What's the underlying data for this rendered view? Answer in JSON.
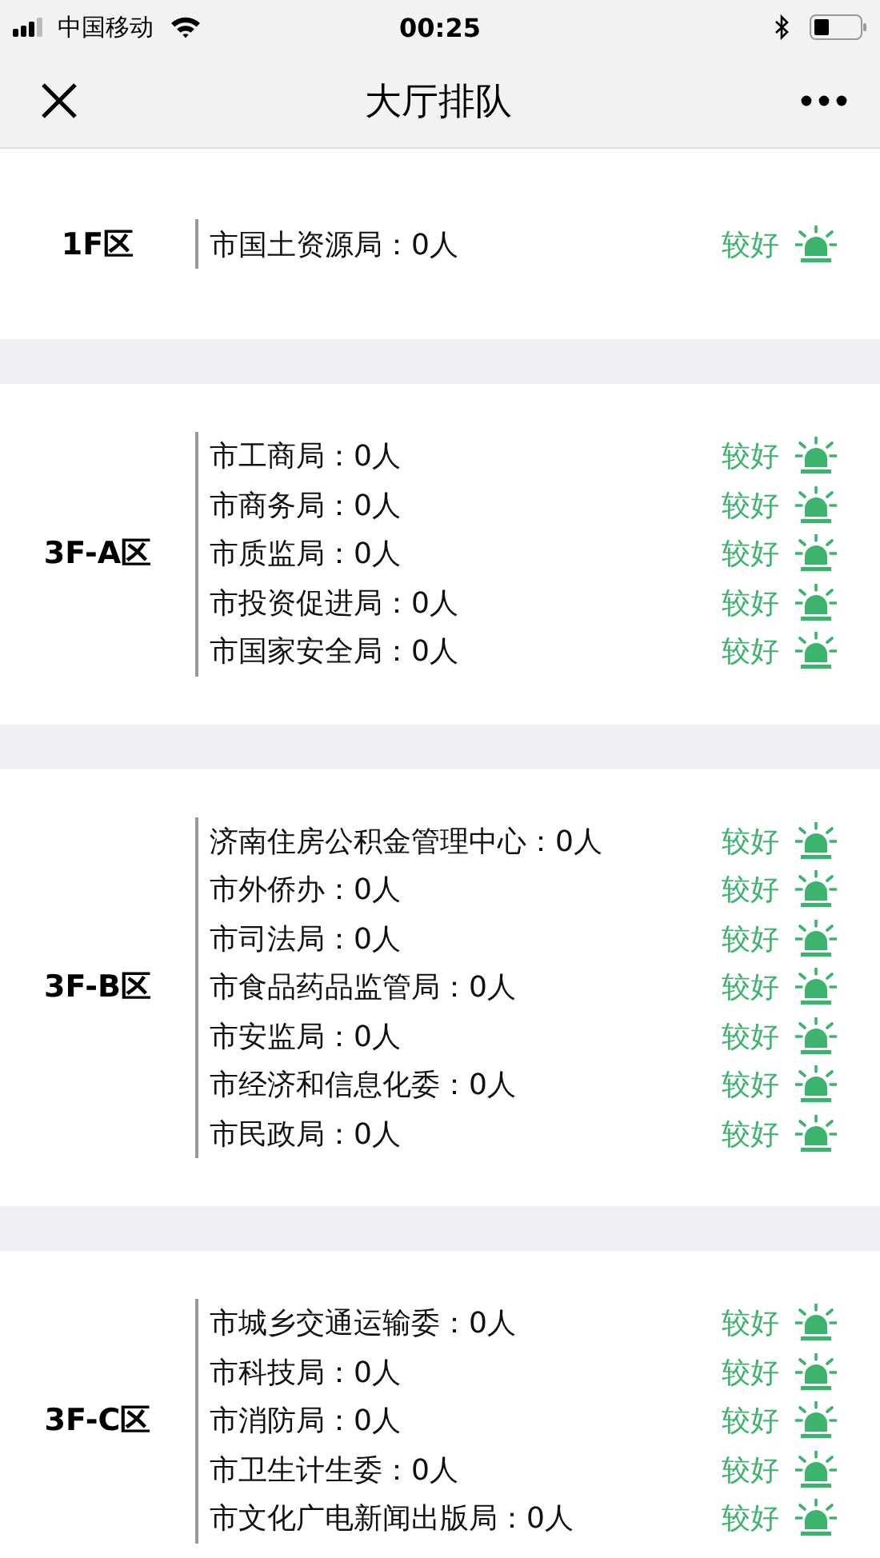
{
  "status_bar": {
    "carrier": "中国移动",
    "time": "00:25"
  },
  "nav_bar": {
    "title": "大厅排队"
  },
  "zones": [
    {
      "name": "1F区",
      "rows": [
        {
          "office": "市国土资源局：0人",
          "status": "较好"
        }
      ]
    },
    {
      "name": "3F-A区",
      "rows": [
        {
          "office": "市工商局：0人",
          "status": "较好"
        },
        {
          "office": "市商务局：0人",
          "status": "较好"
        },
        {
          "office": "市质监局：0人",
          "status": "较好"
        },
        {
          "office": "市投资促进局：0人",
          "status": "较好"
        },
        {
          "office": "市国家安全局：0人",
          "status": "较好"
        }
      ]
    },
    {
      "name": "3F-B区",
      "rows": [
        {
          "office": "济南住房公积金管理中心：0人",
          "status": "较好"
        },
        {
          "office": "市外侨办：0人",
          "status": "较好"
        },
        {
          "office": "市司法局：0人",
          "status": "较好"
        },
        {
          "office": "市食品药品监管局：0人",
          "status": "较好"
        },
        {
          "office": "市安监局：0人",
          "status": "较好"
        },
        {
          "office": "市经济和信息化委：0人",
          "status": "较好"
        },
        {
          "office": "市民政局：0人",
          "status": "较好"
        }
      ]
    },
    {
      "name": "3F-C区",
      "rows": [
        {
          "office": "市城乡交通运输委：0人",
          "status": "较好"
        },
        {
          "office": "市科技局：0人",
          "status": "较好"
        },
        {
          "office": "市消防局：0人",
          "status": "较好"
        },
        {
          "office": "市卫生计生委：0人",
          "status": "较好"
        },
        {
          "office": "市文化广电新闻出版局：0人",
          "status": "较好"
        }
      ]
    }
  ]
}
